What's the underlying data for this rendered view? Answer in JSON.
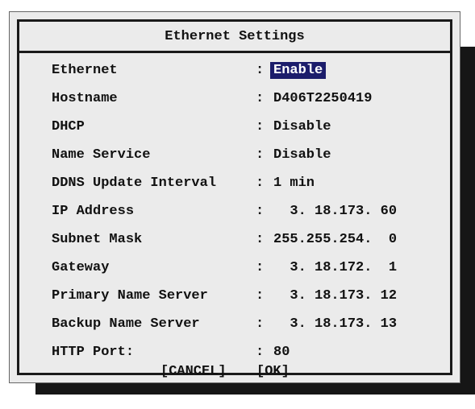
{
  "dialog": {
    "title": "Ethernet Settings",
    "rows": [
      {
        "label": "Ethernet",
        "value": "Enable"
      },
      {
        "label": "Hostname",
        "value": "D406T2250419"
      },
      {
        "label": "DHCP",
        "value": "Disable"
      },
      {
        "label": "Name Service",
        "value": "Disable"
      },
      {
        "label": "DDNS Update Interval",
        "value": "1 min"
      },
      {
        "label": "IP Address",
        "value": "  3. 18.173. 60"
      },
      {
        "label": "Subnet Mask",
        "value": "255.255.254.  0"
      },
      {
        "label": "Gateway",
        "value": "  3. 18.172.  1"
      },
      {
        "label": "Primary Name Server",
        "value": "  3. 18.173. 12"
      },
      {
        "label": "Backup Name Server",
        "value": "  3. 18.173. 13"
      },
      {
        "label": "HTTP Port:",
        "value": "80"
      }
    ],
    "separator": ":",
    "cancel_label": "[CANCEL]",
    "ok_label": "[OK]"
  },
  "colors": {
    "highlight_bg": "#1c1d6b",
    "highlight_fg": "#ffffff",
    "dialog_bg": "#ebebeb",
    "shadow": "#161616"
  }
}
